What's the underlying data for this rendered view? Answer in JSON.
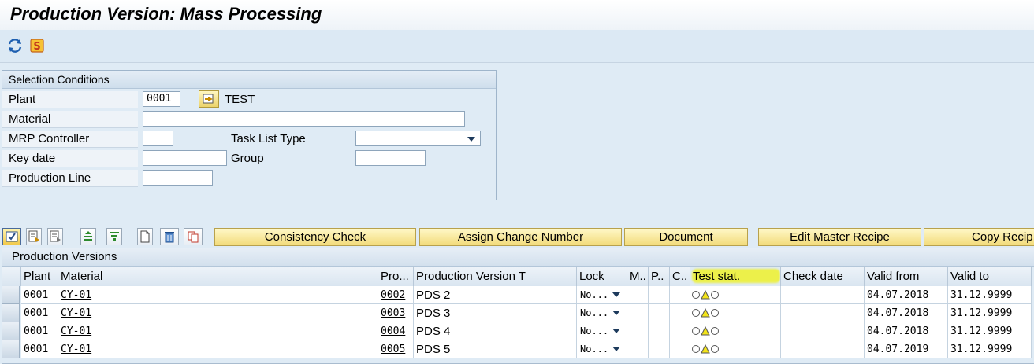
{
  "window": {
    "title": "Production Version: Mass Processing"
  },
  "app_toolbar": {
    "icons": [
      "refresh-icon",
      "program-icon"
    ]
  },
  "selection": {
    "title": "Selection Conditions",
    "plant_label": "Plant",
    "plant_value": "0001",
    "plant_text": "TEST",
    "material_label": "Material",
    "material_value": "",
    "mrp_label": "MRP Controller",
    "mrp_value": "",
    "task_list_type_label": "Task List Type",
    "task_list_type_value": "",
    "key_date_label": "Key date",
    "key_date_value": "",
    "group_label": "Group",
    "group_value": "",
    "prod_line_label": "Production Line",
    "prod_line_value": ""
  },
  "grid_toolbar": {
    "icons": [
      "select-all-icon",
      "details-icon",
      "details-alt-icon",
      "sort-ascending-icon",
      "filter-icon",
      "create-icon",
      "delete-icon",
      "copy-icon"
    ],
    "buttons": [
      "Consistency Check",
      "Assign Change Number",
      "Document",
      "Edit Master Recipe",
      "Copy Recip"
    ]
  },
  "grid": {
    "title": "Production Versions",
    "columns": [
      "Plant",
      "Material",
      "Pro...",
      "Production Version T",
      "Lock",
      "M..",
      "P..",
      "C..",
      "Test stat.",
      "Check date",
      "Valid from",
      "Valid to"
    ],
    "rows": [
      {
        "plant": "0001",
        "material": "CY-01",
        "version": "0002",
        "text": "PDS 2",
        "lock": "No...",
        "check_date": "",
        "valid_from": "04.07.2018",
        "valid_to": "31.12.9999"
      },
      {
        "plant": "0001",
        "material": "CY-01",
        "version": "0003",
        "text": "PDS 3",
        "lock": "No...",
        "check_date": "",
        "valid_from": "04.07.2018",
        "valid_to": "31.12.9999"
      },
      {
        "plant": "0001",
        "material": "CY-01",
        "version": "0004",
        "text": "PDS 4",
        "lock": "No...",
        "check_date": "",
        "valid_from": "04.07.2018",
        "valid_to": "31.12.9999"
      },
      {
        "plant": "0001",
        "material": "CY-01",
        "version": "0005",
        "text": "PDS 5",
        "lock": "No...",
        "check_date": "",
        "valid_from": "04.07.2019",
        "valid_to": "31.12.9999"
      }
    ]
  },
  "colors": {
    "background": "#dfebf5",
    "button_yellow": "#f2db7a",
    "highlight": "#ecf04a"
  }
}
